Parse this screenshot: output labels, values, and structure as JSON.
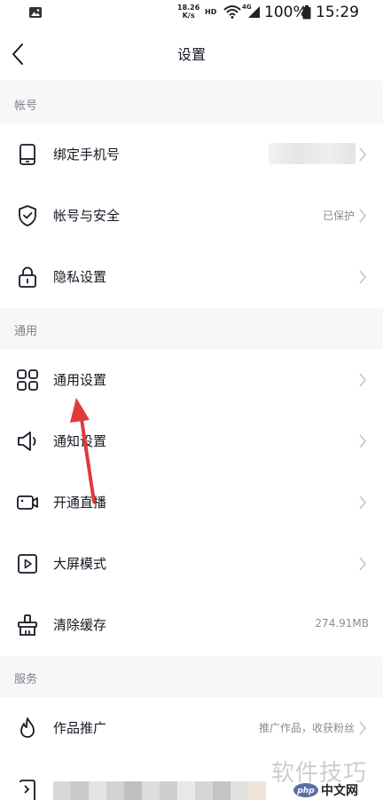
{
  "status_bar": {
    "net_speed_value": "18.26",
    "net_speed_unit": "K/s",
    "hd": "HD",
    "network": "4G",
    "battery": "100%",
    "time": "15:29"
  },
  "nav": {
    "title": "设置"
  },
  "sections": {
    "account": {
      "title": "帐号",
      "items": [
        {
          "label": "绑定手机号",
          "value": ""
        },
        {
          "label": "帐号与安全",
          "value": "已保护"
        },
        {
          "label": "隐私设置",
          "value": ""
        }
      ]
    },
    "general": {
      "title": "通用",
      "items": [
        {
          "label": "通用设置",
          "value": ""
        },
        {
          "label": "通知设置",
          "value": ""
        },
        {
          "label": "开通直播",
          "value": ""
        },
        {
          "label": "大屏模式",
          "value": ""
        },
        {
          "label": "清除缓存",
          "value": "274.91MB"
        }
      ]
    },
    "service": {
      "title": "服务",
      "items": [
        {
          "label": "作品推广",
          "value": "推广作品，收获粉丝"
        }
      ]
    }
  },
  "watermark": {
    "text": "软件技巧",
    "logo_text": "php中文网"
  },
  "colors": {
    "annotation_arrow": "#e03a3a",
    "section_bg": "#f7f7f8"
  }
}
